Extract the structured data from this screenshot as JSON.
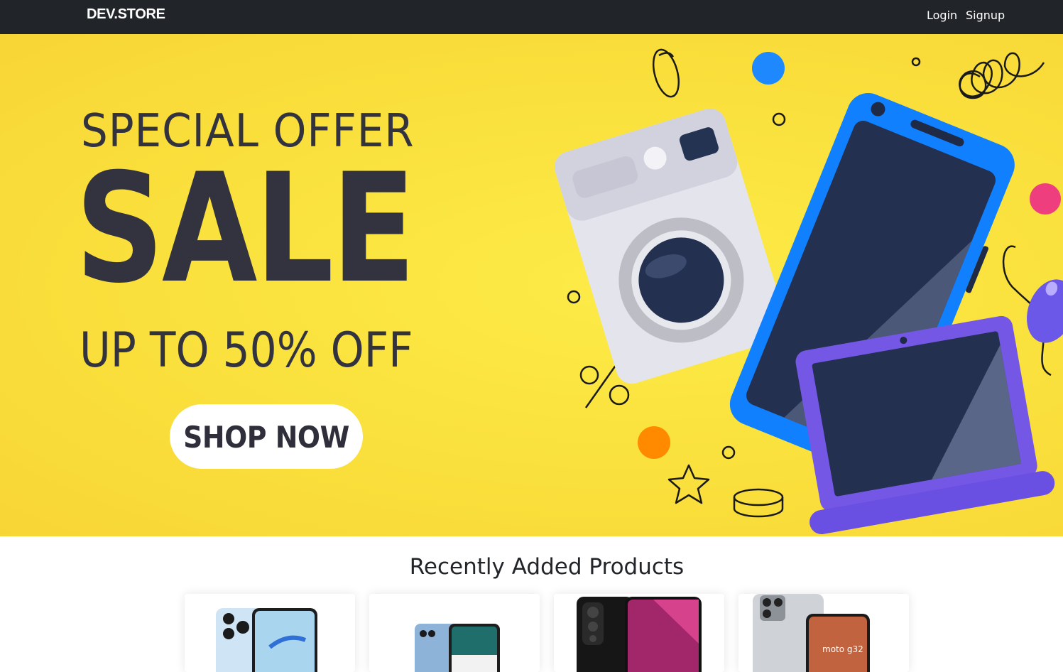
{
  "navbar": {
    "brand": "DEV.STORE",
    "login": "Login",
    "signup": "Signup"
  },
  "hero": {
    "line1": "SPECIAL OFFER",
    "line2": "SALE",
    "line3": "UP TO 50% OFF",
    "cta": "SHOP NOW",
    "background_color": "#fae03c",
    "text_color": "#33333f"
  },
  "products_section": {
    "title": "Recently Added Products",
    "items": [
      {
        "image": "phone-light-blue-5g"
      },
      {
        "image": "phone-blue-teal"
      },
      {
        "image": "phone-black-magenta-5g"
      },
      {
        "image": "moto-g32-silver"
      }
    ]
  }
}
